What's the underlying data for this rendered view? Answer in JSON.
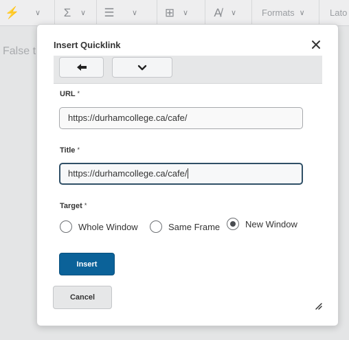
{
  "toolbar": {
    "formats_label": "Formats",
    "font_label": "Lato",
    "icons": [
      "math-icon",
      "sigma-icon",
      "list-icon",
      "table-icon",
      "format-icon"
    ]
  },
  "editor": {
    "background_text": "False t"
  },
  "dialog": {
    "title": "Insert Quicklink",
    "url_label": "URL",
    "url_value": "https://durhamcollege.ca/cafe/",
    "title_label": "Title",
    "title_value": "https://durhamcollege.ca/cafe/",
    "target_label": "Target",
    "required_marker": "*",
    "target_options": [
      {
        "label": "Whole Window",
        "checked": false
      },
      {
        "label": "Same Frame",
        "checked": false
      },
      {
        "label": "New Window",
        "checked": true
      }
    ],
    "insert_label": "Insert",
    "cancel_label": "Cancel"
  },
  "colors": {
    "primary": "#0b6299",
    "overlay": "#e4e5e6",
    "focus_border": "#2f4f66"
  }
}
